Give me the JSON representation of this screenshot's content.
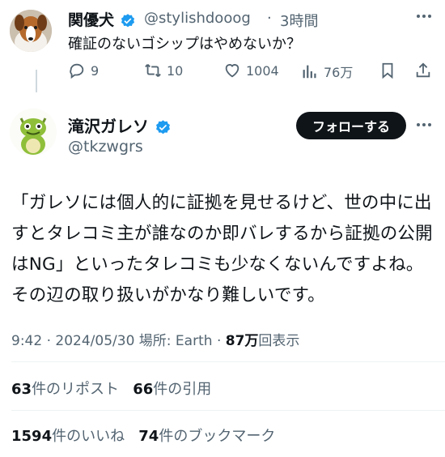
{
  "reply": {
    "name": "関優犬",
    "handle": "@stylishdooog",
    "separator": "·",
    "time": "3時間",
    "text": "確証のないゴシップはやめないか？",
    "actions": {
      "replies": "9",
      "reposts": "10",
      "likes": "1004",
      "views": "76万"
    }
  },
  "main": {
    "name": "滝沢ガレソ",
    "handle": "@tkzwgrs",
    "follow_label": "フォローする",
    "text": "「ガレソには個人的に証拠を見せるけど、世の中に出すとタレコミ主が誰なのか即バレするから証拠の公開はNG」といったタレコミも少なくないんですよね。その辺の取り扱いがかなり難しいです。",
    "time": "9:42",
    "date": "2024/05/30",
    "location": "場所: Earth",
    "views_count": "87万",
    "views_label": "回表示",
    "reposts_count": "63",
    "reposts_label": "件のリポスト",
    "quotes_count": "66",
    "quotes_label": "件の引用",
    "likes_count": "1594",
    "likes_label": "件のいいね",
    "bookmarks_count": "74",
    "bookmarks_label": "件のブックマーク"
  },
  "colors": {
    "text": "#0f1419",
    "secondary": "#536471",
    "verified": "#1d9bf0",
    "button": "#0f1419"
  }
}
